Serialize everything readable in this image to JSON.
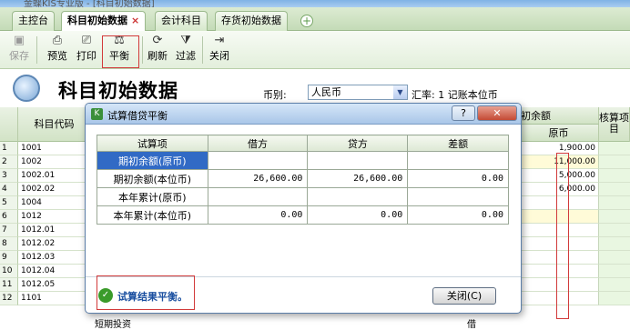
{
  "window": {
    "title": "金蝶KIS专业版 - [科目初始数据]"
  },
  "tabs": [
    {
      "label": "主控台"
    },
    {
      "label": "科目初始数据",
      "close": "×"
    },
    {
      "label": "会计科目"
    },
    {
      "label": "存货初始数据"
    }
  ],
  "toolbar": {
    "save": "保存",
    "preview": "预览",
    "print": "打印",
    "balance": "平衡",
    "refresh": "刷新",
    "filter": "过滤",
    "close": "关闭"
  },
  "header": {
    "title": "科目初始数据",
    "currency_label": "币别:",
    "currency_value": "人民币",
    "rate_text": "汇率: 1 记账本位币"
  },
  "grid": {
    "col_code": "科目代码",
    "col_initial": "初余额",
    "col_original": "原币",
    "col_check": "核算项目",
    "row_numbers": [
      "1",
      "2",
      "3",
      "4",
      "5",
      "6",
      "7",
      "8",
      "9",
      "10",
      "11",
      "12"
    ],
    "rows": [
      {
        "code": "1001",
        "value": "1,900.00"
      },
      {
        "code": "1002",
        "value": "11,000.00"
      },
      {
        "code": "1002.01",
        "value": "5,000.00"
      },
      {
        "code": "1002.02",
        "value": "6,000.00"
      },
      {
        "code": "1004",
        "value": ""
      },
      {
        "code": "1012",
        "value": ""
      },
      {
        "code": "1012.01",
        "value": ""
      },
      {
        "code": "1012.02",
        "value": ""
      },
      {
        "code": "1012.03",
        "value": ""
      },
      {
        "code": "1012.04",
        "value": ""
      },
      {
        "code": "1012.05",
        "value": ""
      },
      {
        "code": "1101",
        "value": ""
      }
    ],
    "bottom_name": "短期投资",
    "bottom_dir": "借"
  },
  "dialog": {
    "title": "试算借贷平衡",
    "help": "?",
    "close_x": "✕",
    "columns": [
      "试算项",
      "借方",
      "贷方",
      "差额"
    ],
    "rows": [
      {
        "item": "期初余额(原币)",
        "debit": "",
        "credit": "",
        "diff": ""
      },
      {
        "item": "期初余额(本位币)",
        "debit": "26,600.00",
        "credit": "26,600.00",
        "diff": "0.00"
      },
      {
        "item": "本年累计(原币)",
        "debit": "",
        "credit": "",
        "diff": ""
      },
      {
        "item": "本年累计(本位币)",
        "debit": "0.00",
        "credit": "0.00",
        "diff": "0.00"
      }
    ],
    "result": "试算结果平衡。",
    "close_button": "关闭(C)"
  }
}
